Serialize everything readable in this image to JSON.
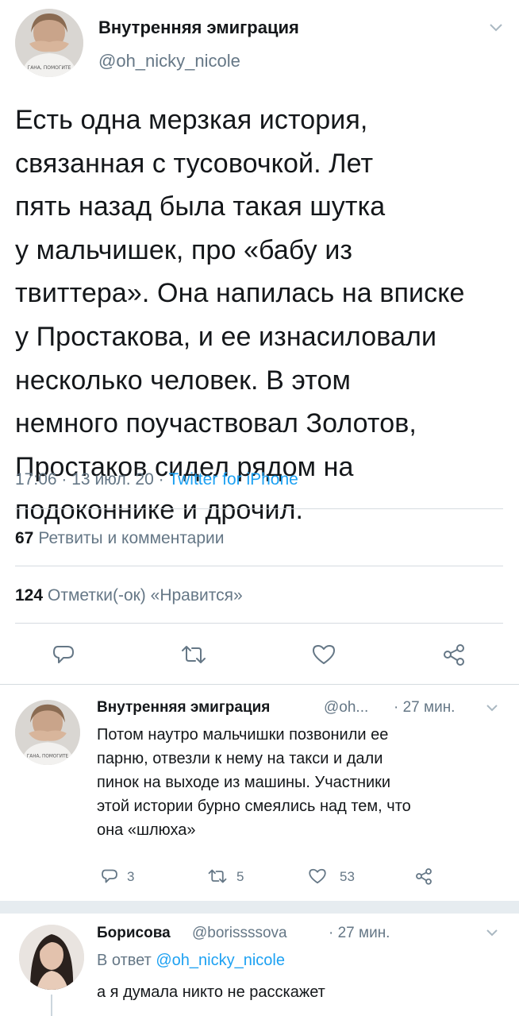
{
  "main_tweet": {
    "author_name": "Внутренняя эмиграция",
    "author_handle": "@oh_nicky_nicole",
    "avatar_caption": "ГАНА, ПОМОГИТЕ",
    "text": "Есть одна мерзкая история, связанная с тусовочкой. Лет пять назад была такая шутка у мальчишек, про «бабу из твиттера». Она напилась на вписке у Простакова, и ее изнасиловали несколько человек. В этом немного поучаствовал Золотов, Простаков сидел рядом на подоконнике и дрочил.",
    "lines": [
      "Есть одна мерзкая история,",
      "связанная с тусовочкой. Лет",
      "пять назад была такая шутка",
      "у мальчишек, про «бабу из",
      "твиттера». Она напилась на вписке",
      "у Простакова, и ее изнасиловали",
      "несколько человек. В этом",
      "немного поучаствовал Золотов,",
      "Простаков сидел рядом на",
      "подоконнике и дрочил."
    ],
    "time": "17:06",
    "date": "13 июл. 20",
    "source": "Twitter for iPhone",
    "separator": "·",
    "retweets_count": "67",
    "retweets_label": "Ретвиты и комментарии",
    "likes_count": "124",
    "likes_label": "Отметки(-ок) «Нравится»",
    "icons": [
      "reply-icon",
      "retweet-icon",
      "like-icon",
      "share-icon"
    ]
  },
  "reply1": {
    "author_name": "Внутренняя эмиграция",
    "author_handle": "@oh...",
    "time_ago": "· 27 мин.",
    "lines": [
      "Потом наутро мальчишки позвонили ее",
      "парню, отвезли к нему на такси и дали",
      "пинок на выходе из машины. Участники",
      "этой истории бурно смеялись над тем, что",
      "она «шлюха»"
    ],
    "reply_count": "3",
    "retweet_count": "5",
    "like_count": "53"
  },
  "reply2": {
    "author_name": "Борисова",
    "author_handle": "@borissssova",
    "time_ago": "· 27 мин.",
    "reply_to_prefix": "В ответ",
    "reply_to_handle": "@oh_nicky_nicole",
    "text": "а я думала никто не расскажет"
  },
  "colors": {
    "text": "#14171a",
    "secondary": "#657786",
    "accent": "#1da1f2",
    "divider": "#d5dbe0",
    "gap": "#e6ecf0"
  }
}
